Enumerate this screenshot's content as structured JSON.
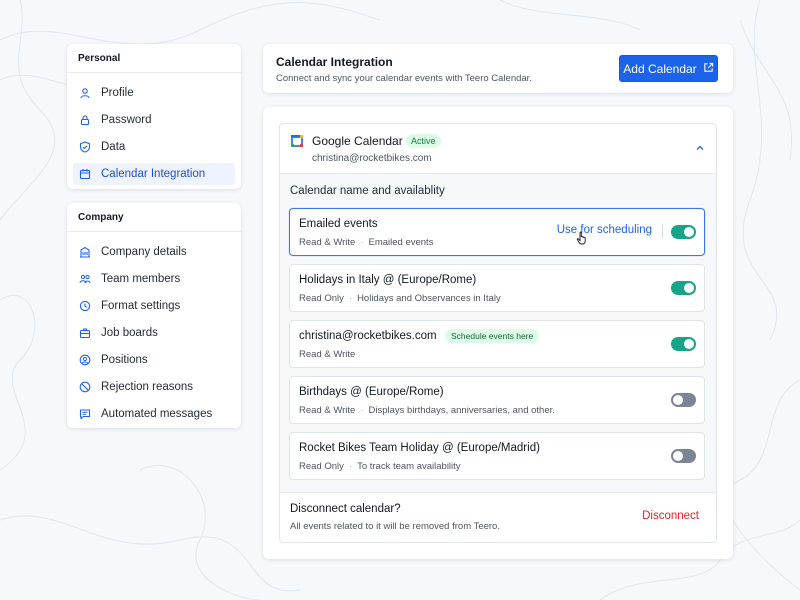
{
  "sidebar": {
    "personal": {
      "heading": "Personal",
      "items": [
        {
          "label": "Profile",
          "icon": "user-icon"
        },
        {
          "label": "Password",
          "icon": "lock-icon"
        },
        {
          "label": "Data",
          "icon": "shield-icon"
        },
        {
          "label": "Calendar Integration",
          "icon": "calendar-icon",
          "active": true
        }
      ]
    },
    "company": {
      "heading": "Company",
      "items": [
        {
          "label": "Company details",
          "icon": "building-icon"
        },
        {
          "label": "Team members",
          "icon": "users-icon"
        },
        {
          "label": "Format settings",
          "icon": "clock-icon"
        },
        {
          "label": "Job boards",
          "icon": "briefcase-icon"
        },
        {
          "label": "Positions",
          "icon": "user-circle-icon"
        },
        {
          "label": "Rejection reasons",
          "icon": "ban-icon"
        },
        {
          "label": "Automated messages",
          "icon": "message-icon"
        }
      ]
    }
  },
  "header": {
    "title": "Calendar Integration",
    "subtitle": "Connect and sync your calendar events with Teero Calendar.",
    "add_button": "Add Calendar"
  },
  "provider": {
    "name": "Google Calendar",
    "status": "Active",
    "email": "christina@rocketbikes.com"
  },
  "section_title": "Calendar name and availablity",
  "calendars": [
    {
      "name": "Emailed events",
      "access": "Read & Write",
      "description": "Emailed events",
      "enabled": true,
      "selected": true,
      "action": "Use for scheduling"
    },
    {
      "name": "Holidays in Italy @ (Europe/Rome)",
      "access": "Read Only",
      "description": "Holidays and Observances in Italy",
      "enabled": true
    },
    {
      "name": "christina@rocketbikes.com",
      "access": "Read & Write",
      "badge": "Schedule events here",
      "enabled": true
    },
    {
      "name": "Birthdays @ (Europe/Rome)",
      "access": "Read & Write",
      "description": "Displays birthdays, anniversaries, and other.",
      "enabled": false
    },
    {
      "name": "Rocket Bikes Team Holiday @ (Europe/Madrid)",
      "access": "Read Only",
      "description": "To track team availability",
      "enabled": false
    }
  ],
  "disconnect": {
    "title": "Disconnect calendar?",
    "subtitle": "All events related to it will be removed from Teero.",
    "button": "Disconnect"
  },
  "colors": {
    "primary": "#1d63ea",
    "toggle_on": "#17a589",
    "toggle_off": "#7c8596",
    "danger": "#dc2626",
    "badge_bg": "#dcfce7"
  }
}
